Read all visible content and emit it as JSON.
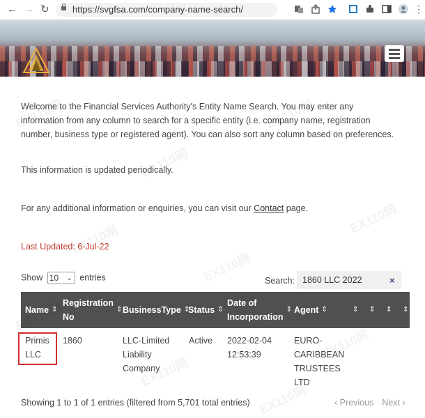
{
  "browser": {
    "url": "https://svgfsa.com/company-name-search/"
  },
  "content": {
    "intro": "Welcome to the Financial Services Authority's Entity Name Search. You may enter any information from any column to search for a specific entity (i.e. company name, registration number, business type or registered agent). You can also sort any column based on preferences.",
    "updated_note": "This information is updated periodically.",
    "contact_prefix": "For any additional information or enquiries, you can visit our ",
    "contact_link": "Contact",
    "contact_suffix": " page.",
    "last_updated": "Last Updated:  6-Jul-22"
  },
  "table_controls": {
    "show_label": "Show",
    "entries_value": "10",
    "entries_label": "entries",
    "search_label": "Search:",
    "search_value": "1860 LLC 2022",
    "clear_icon": "close-icon"
  },
  "table": {
    "headers": [
      {
        "label": "Name",
        "sort": "◆"
      },
      {
        "label": "Registration No",
        "sort": "◆"
      },
      {
        "label": "BusinessType",
        "sort": "◆"
      },
      {
        "label": "Status",
        "sort": "◆"
      },
      {
        "label": "Date of Incorporation",
        "sort": "◆"
      },
      {
        "label": "Agent",
        "sort": "◆"
      },
      {
        "label": "",
        "sort": "◆"
      },
      {
        "label": "",
        "sort": "◆"
      },
      {
        "label": "",
        "sort": "◆"
      }
    ],
    "rows": [
      {
        "name": "Primis LLC",
        "reg_no": "1860",
        "business_type": "LLC-Limited Liability Company",
        "status": "Active",
        "date": "2022-02-04 12:53:39",
        "agent": "EURO-CARIBBEAN TRUSTEES LTD"
      }
    ]
  },
  "footer": {
    "info": "Showing 1 to 1 of 1 entries (filtered from 5,701 total entries)",
    "previous": "‹ Previous",
    "next": "Next ›"
  },
  "watermark": "EX110网"
}
